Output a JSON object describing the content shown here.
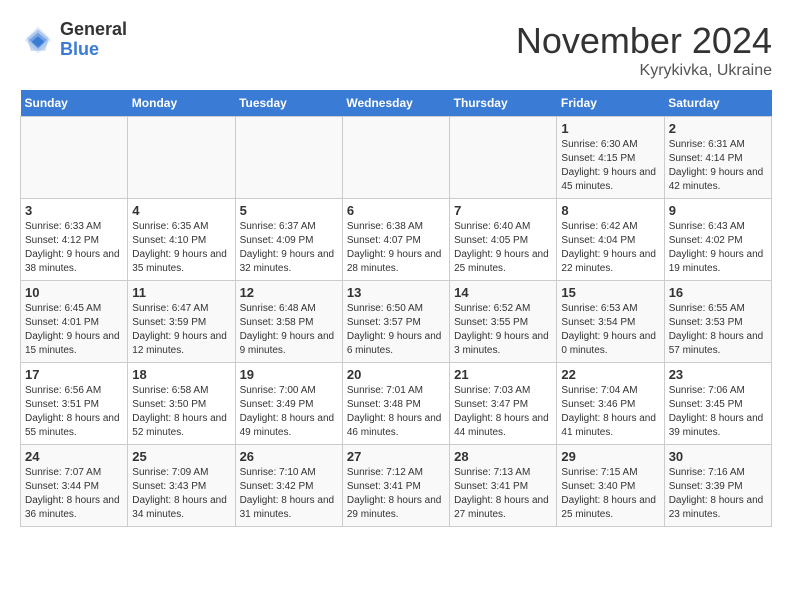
{
  "logo": {
    "general": "General",
    "blue": "Blue"
  },
  "header": {
    "month": "November 2024",
    "location": "Kyrykivka, Ukraine"
  },
  "weekdays": [
    "Sunday",
    "Monday",
    "Tuesday",
    "Wednesday",
    "Thursday",
    "Friday",
    "Saturday"
  ],
  "weeks": [
    [
      {
        "day": "",
        "info": ""
      },
      {
        "day": "",
        "info": ""
      },
      {
        "day": "",
        "info": ""
      },
      {
        "day": "",
        "info": ""
      },
      {
        "day": "",
        "info": ""
      },
      {
        "day": "1",
        "info": "Sunrise: 6:30 AM\nSunset: 4:15 PM\nDaylight: 9 hours and 45 minutes."
      },
      {
        "day": "2",
        "info": "Sunrise: 6:31 AM\nSunset: 4:14 PM\nDaylight: 9 hours and 42 minutes."
      }
    ],
    [
      {
        "day": "3",
        "info": "Sunrise: 6:33 AM\nSunset: 4:12 PM\nDaylight: 9 hours and 38 minutes."
      },
      {
        "day": "4",
        "info": "Sunrise: 6:35 AM\nSunset: 4:10 PM\nDaylight: 9 hours and 35 minutes."
      },
      {
        "day": "5",
        "info": "Sunrise: 6:37 AM\nSunset: 4:09 PM\nDaylight: 9 hours and 32 minutes."
      },
      {
        "day": "6",
        "info": "Sunrise: 6:38 AM\nSunset: 4:07 PM\nDaylight: 9 hours and 28 minutes."
      },
      {
        "day": "7",
        "info": "Sunrise: 6:40 AM\nSunset: 4:05 PM\nDaylight: 9 hours and 25 minutes."
      },
      {
        "day": "8",
        "info": "Sunrise: 6:42 AM\nSunset: 4:04 PM\nDaylight: 9 hours and 22 minutes."
      },
      {
        "day": "9",
        "info": "Sunrise: 6:43 AM\nSunset: 4:02 PM\nDaylight: 9 hours and 19 minutes."
      }
    ],
    [
      {
        "day": "10",
        "info": "Sunrise: 6:45 AM\nSunset: 4:01 PM\nDaylight: 9 hours and 15 minutes."
      },
      {
        "day": "11",
        "info": "Sunrise: 6:47 AM\nSunset: 3:59 PM\nDaylight: 9 hours and 12 minutes."
      },
      {
        "day": "12",
        "info": "Sunrise: 6:48 AM\nSunset: 3:58 PM\nDaylight: 9 hours and 9 minutes."
      },
      {
        "day": "13",
        "info": "Sunrise: 6:50 AM\nSunset: 3:57 PM\nDaylight: 9 hours and 6 minutes."
      },
      {
        "day": "14",
        "info": "Sunrise: 6:52 AM\nSunset: 3:55 PM\nDaylight: 9 hours and 3 minutes."
      },
      {
        "day": "15",
        "info": "Sunrise: 6:53 AM\nSunset: 3:54 PM\nDaylight: 9 hours and 0 minutes."
      },
      {
        "day": "16",
        "info": "Sunrise: 6:55 AM\nSunset: 3:53 PM\nDaylight: 8 hours and 57 minutes."
      }
    ],
    [
      {
        "day": "17",
        "info": "Sunrise: 6:56 AM\nSunset: 3:51 PM\nDaylight: 8 hours and 55 minutes."
      },
      {
        "day": "18",
        "info": "Sunrise: 6:58 AM\nSunset: 3:50 PM\nDaylight: 8 hours and 52 minutes."
      },
      {
        "day": "19",
        "info": "Sunrise: 7:00 AM\nSunset: 3:49 PM\nDaylight: 8 hours and 49 minutes."
      },
      {
        "day": "20",
        "info": "Sunrise: 7:01 AM\nSunset: 3:48 PM\nDaylight: 8 hours and 46 minutes."
      },
      {
        "day": "21",
        "info": "Sunrise: 7:03 AM\nSunset: 3:47 PM\nDaylight: 8 hours and 44 minutes."
      },
      {
        "day": "22",
        "info": "Sunrise: 7:04 AM\nSunset: 3:46 PM\nDaylight: 8 hours and 41 minutes."
      },
      {
        "day": "23",
        "info": "Sunrise: 7:06 AM\nSunset: 3:45 PM\nDaylight: 8 hours and 39 minutes."
      }
    ],
    [
      {
        "day": "24",
        "info": "Sunrise: 7:07 AM\nSunset: 3:44 PM\nDaylight: 8 hours and 36 minutes."
      },
      {
        "day": "25",
        "info": "Sunrise: 7:09 AM\nSunset: 3:43 PM\nDaylight: 8 hours and 34 minutes."
      },
      {
        "day": "26",
        "info": "Sunrise: 7:10 AM\nSunset: 3:42 PM\nDaylight: 8 hours and 31 minutes."
      },
      {
        "day": "27",
        "info": "Sunrise: 7:12 AM\nSunset: 3:41 PM\nDaylight: 8 hours and 29 minutes."
      },
      {
        "day": "28",
        "info": "Sunrise: 7:13 AM\nSunset: 3:41 PM\nDaylight: 8 hours and 27 minutes."
      },
      {
        "day": "29",
        "info": "Sunrise: 7:15 AM\nSunset: 3:40 PM\nDaylight: 8 hours and 25 minutes."
      },
      {
        "day": "30",
        "info": "Sunrise: 7:16 AM\nSunset: 3:39 PM\nDaylight: 8 hours and 23 minutes."
      }
    ]
  ]
}
